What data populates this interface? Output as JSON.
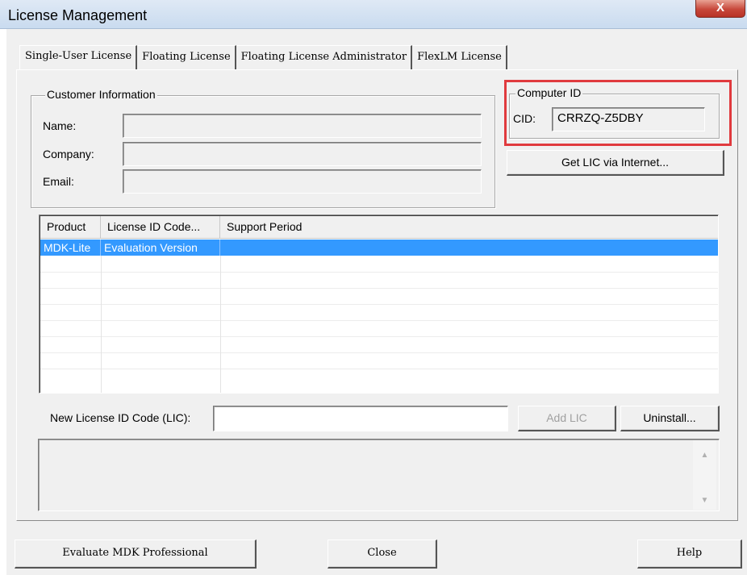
{
  "window": {
    "title": "License Management",
    "close_glyph": "X"
  },
  "tabs": [
    {
      "label": "Single-User License"
    },
    {
      "label": "Floating License"
    },
    {
      "label": "Floating License Administrator"
    },
    {
      "label": "FlexLM License"
    }
  ],
  "customer": {
    "legend": "Customer Information",
    "name_label": "Name:",
    "name_value": "",
    "company_label": "Company:",
    "company_value": "",
    "email_label": "Email:",
    "email_value": ""
  },
  "computer": {
    "legend": "Computer ID",
    "cid_label": "CID:",
    "cid_value": "CRRZQ-Z5DBY",
    "highlight_color": "#e03a3e"
  },
  "get_lic_button": "Get LIC via Internet...",
  "license_table": {
    "columns": [
      "Product",
      "License ID Code...",
      "Support Period"
    ],
    "rows": [
      {
        "product": "MDK-Lite",
        "license_id": "Evaluation Version",
        "support": "",
        "selected": true
      }
    ],
    "selection_color": "#3399ff"
  },
  "new_lic": {
    "label": "New License ID Code (LIC):",
    "value": "",
    "add_button": "Add LIC",
    "uninstall_button": "Uninstall..."
  },
  "output_box": {
    "text": "",
    "scroll_up_icon": "scroll-up-arrow",
    "scroll_down_icon": "scroll-down-arrow"
  },
  "footer": {
    "evaluate_button": "Evaluate MDK Professional",
    "close_button": "Close",
    "help_button": "Help"
  }
}
